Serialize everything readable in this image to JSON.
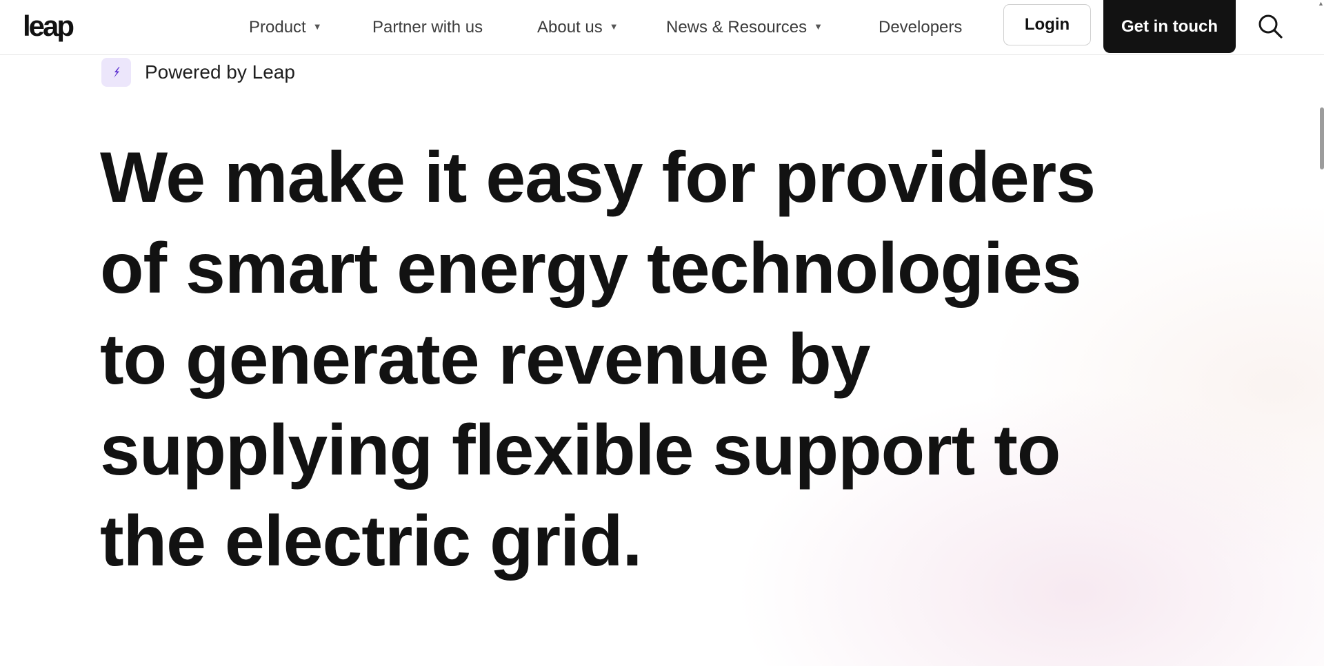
{
  "header": {
    "logo_text": "leap",
    "nav": [
      {
        "label": "Product",
        "has_dropdown": true
      },
      {
        "label": "Partner with us",
        "has_dropdown": false
      },
      {
        "label": "About us",
        "has_dropdown": true
      },
      {
        "label": "News & Resources",
        "has_dropdown": true
      },
      {
        "label": "Developers",
        "has_dropdown": false
      }
    ],
    "login_label": "Login",
    "cta_label": "Get in touch",
    "search_icon": "search-icon",
    "caret_glyph": "▼"
  },
  "powered": {
    "text": "Powered by Leap",
    "icon": "lightning-bolt-icon"
  },
  "hero": {
    "lines": [
      "We make it easy for providers",
      "of smart energy technologies",
      "to generate revenue by",
      "supplying flexible support to",
      "the electric grid."
    ]
  },
  "colors": {
    "text": "#121212",
    "cta_bg": "#121212",
    "badge_bg": "#ece6fb",
    "bolt": "#5b2fd0"
  }
}
